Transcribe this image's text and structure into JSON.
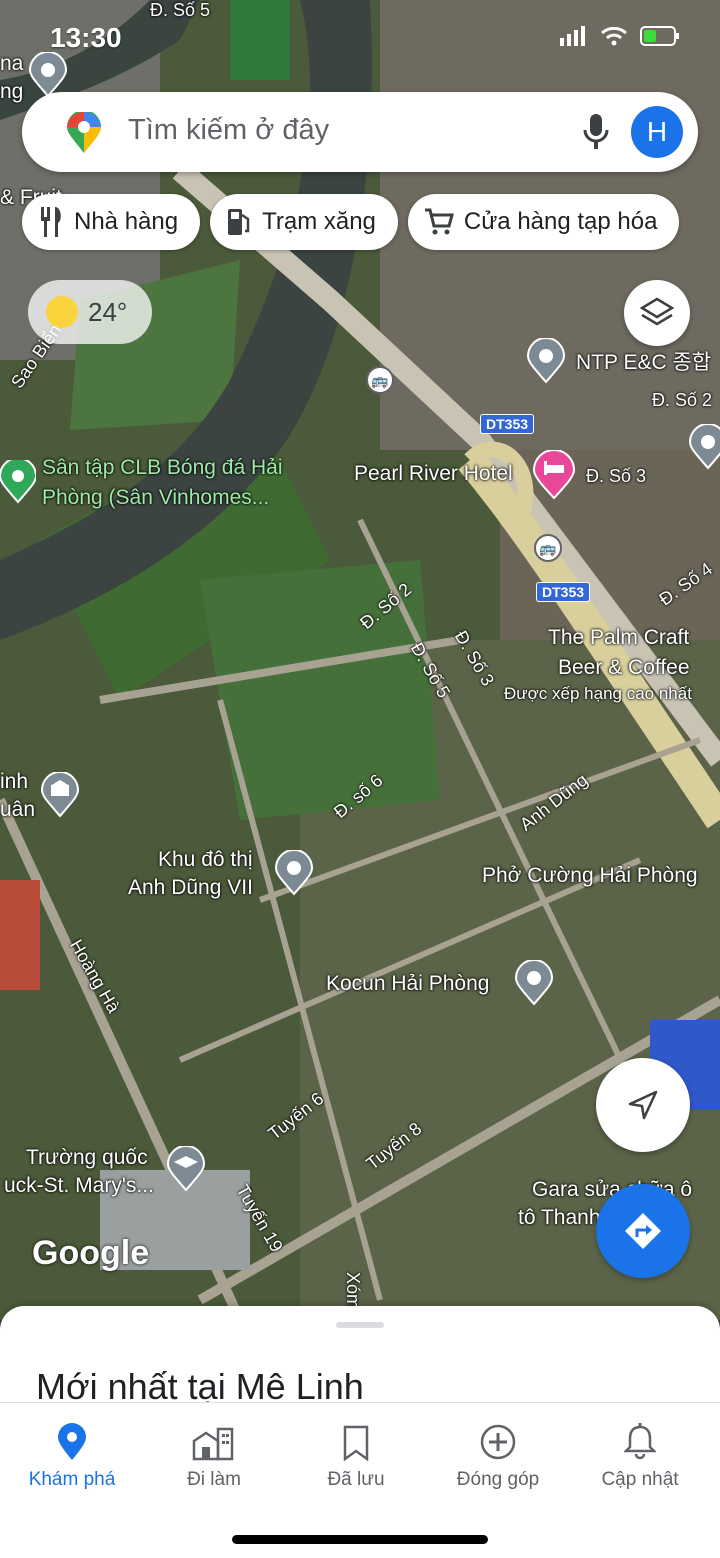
{
  "status": {
    "time": "13:30"
  },
  "search": {
    "placeholder": "Tìm kiếm ở đây",
    "avatar_letter": "H"
  },
  "chips": [
    {
      "label": "Nhà hàng",
      "icon": "restaurant-icon"
    },
    {
      "label": "Trạm xăng",
      "icon": "gas-station-icon"
    },
    {
      "label": "Cửa hàng tạp hóa",
      "icon": "grocery-cart-icon"
    }
  ],
  "weather": {
    "temp": "24°",
    "icon": "sun-icon"
  },
  "map_labels": {
    "ntp": "NTP E&C 종합",
    "so2a": "Đ. Số 2",
    "dt353a": "DT353",
    "dt353b": "DT353",
    "pearl": "Pearl River Hotel",
    "so3": "Đ. Số 3",
    "so4": "Đ. Số 4",
    "san_tap_1": "Sân tập CLB Bóng đá Hải",
    "san_tap_2": "Phòng (Sân Vinhomes...",
    "so2b": "Đ. Số 2",
    "so5": "Đ. Số 5",
    "so3b": "Đ. Số 3",
    "palm_1": "The Palm Craft",
    "palm_2": "Beer & Coffee",
    "palm_3": "Được xếp hạng cao nhất",
    "so6": "Đ. số 6",
    "anh_dung": "Anh Dũng",
    "khu_1": "Khu đô thị",
    "khu_2": "Anh Dũng VII",
    "pho": "Phở Cường Hải Phòng",
    "hoang_ha": "Hoàng Hà",
    "kocun": "Kocun Hải Phòng",
    "tuyen6": "Tuyến 6",
    "tuyen8": "Tuyến 8",
    "tuyen19": "Tuyến 19",
    "truong_1": "Trường quốc",
    "truong_2": "uck-St. Mary's...",
    "gara_1": "Gara sửa chữa ô",
    "gara_2": "tô Thanh",
    "inh": "inh",
    "uan": "uân",
    "sao_bien": "Sao Biển",
    "fruit": "& Fruit",
    "ng": "ng",
    "na": "na",
    "xom": "Xóm",
    "so5top": "Đ. Số 5"
  },
  "google_logo": "Google",
  "sheet": {
    "title": "Mới nhất tại Mê Linh"
  },
  "nav": [
    {
      "label": "Khám phá",
      "icon": "explore-pin-icon",
      "active": true
    },
    {
      "label": "Đi làm",
      "icon": "commute-icon",
      "active": false
    },
    {
      "label": "Đã lưu",
      "icon": "bookmark-icon",
      "active": false
    },
    {
      "label": "Đóng góp",
      "icon": "add-circle-icon",
      "active": false
    },
    {
      "label": "Cập nhật",
      "icon": "bell-icon",
      "active": false
    }
  ],
  "colors": {
    "accent": "#1a73e8",
    "hotel_pin": "#e8479a",
    "park_pin": "#2fa85a"
  }
}
